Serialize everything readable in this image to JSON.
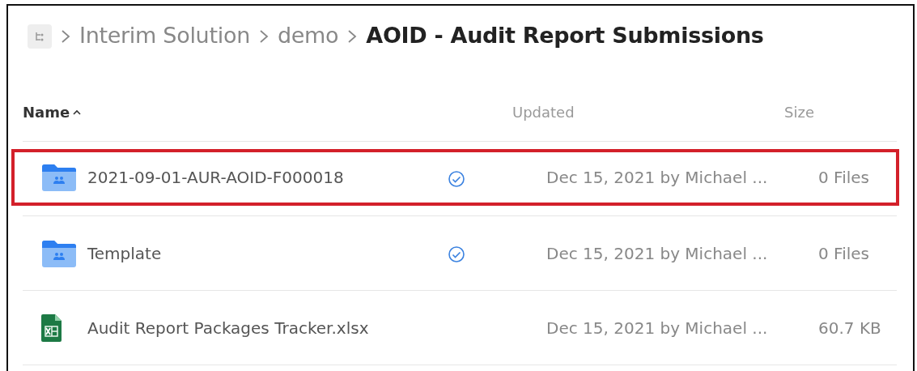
{
  "breadcrumb": [
    {
      "label": "Interim Solution",
      "selected": false
    },
    {
      "label": "demo",
      "selected": false
    },
    {
      "label": "AOID - Audit Report Submissions",
      "selected": true
    }
  ],
  "table": {
    "columns": [
      {
        "label": "Name",
        "sorted": true
      },
      {
        "label": "Updated"
      },
      {
        "label": "Size"
      }
    ],
    "rows": [
      {
        "kind": "folder",
        "name": "2021-09-01-AUR-AOID-F000018",
        "synced": true,
        "updated": "Dec 15, 2021 by Michael ...",
        "size": "0 Files",
        "highlighted": true
      },
      {
        "kind": "folder",
        "name": "Template",
        "synced": true,
        "updated": "Dec 15, 2021 by Michael ...",
        "size": "0 Files",
        "highlighted": false
      },
      {
        "kind": "spreadsheet",
        "name": "Audit Report Packages Tracker.xlsx",
        "synced": false,
        "updated": "Dec 15, 2021 by Michael ...",
        "size": "60.7 KB",
        "highlighted": false
      }
    ]
  }
}
